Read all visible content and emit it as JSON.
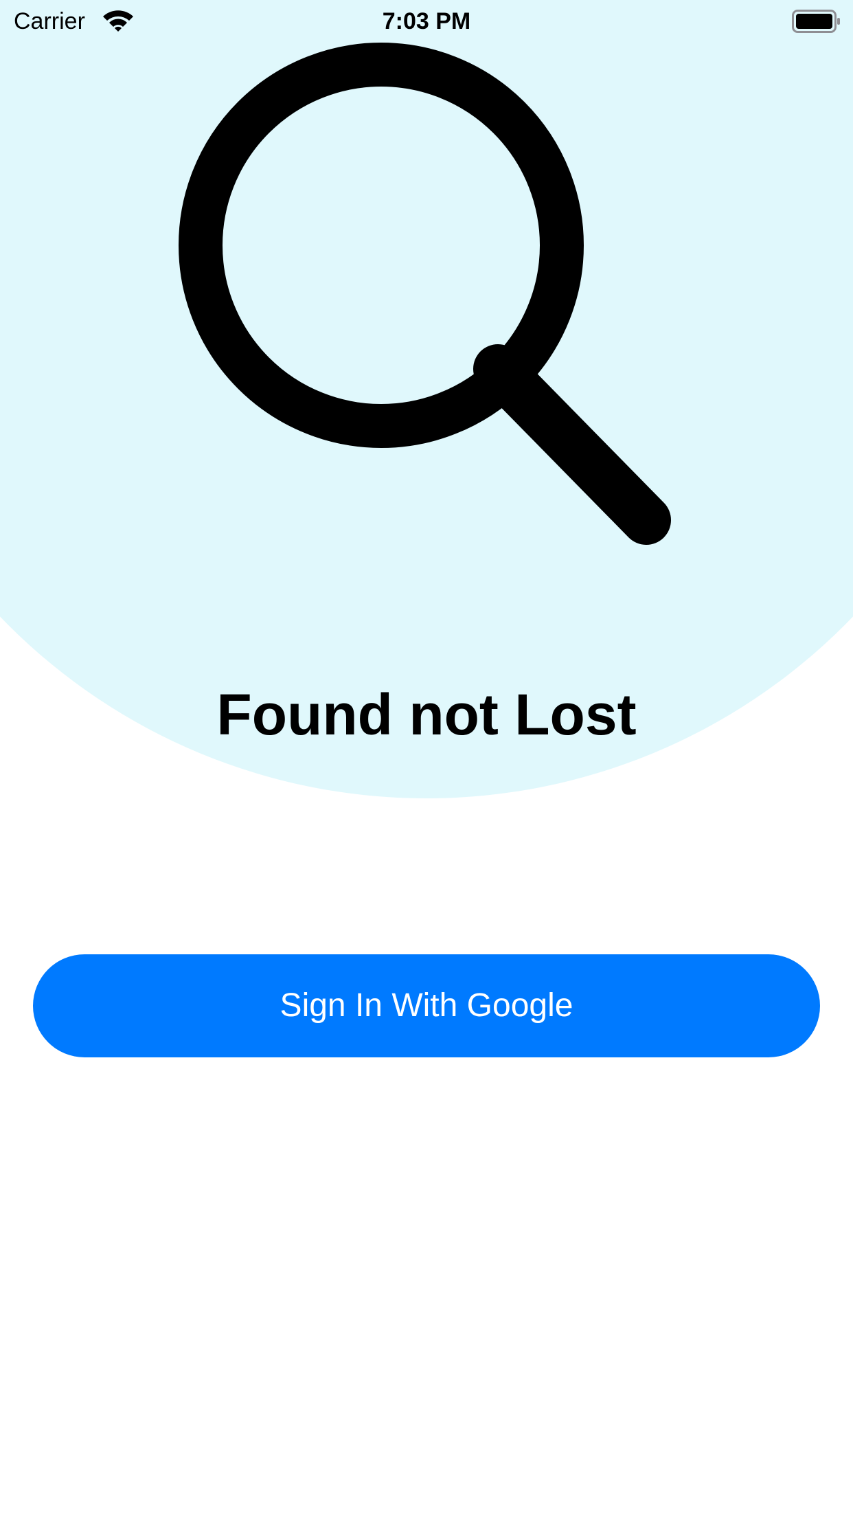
{
  "status_bar": {
    "carrier": "Carrier",
    "time": "7:03 PM",
    "wifi_icon": "wifi-icon",
    "battery_icon": "battery-full-icon"
  },
  "hero": {
    "icon": "magnifying-glass-icon",
    "background_color": "#e0f8fc",
    "title": "Found not Lost"
  },
  "actions": {
    "sign_in_label": "Sign In With Google",
    "button_color": "#007aff"
  }
}
